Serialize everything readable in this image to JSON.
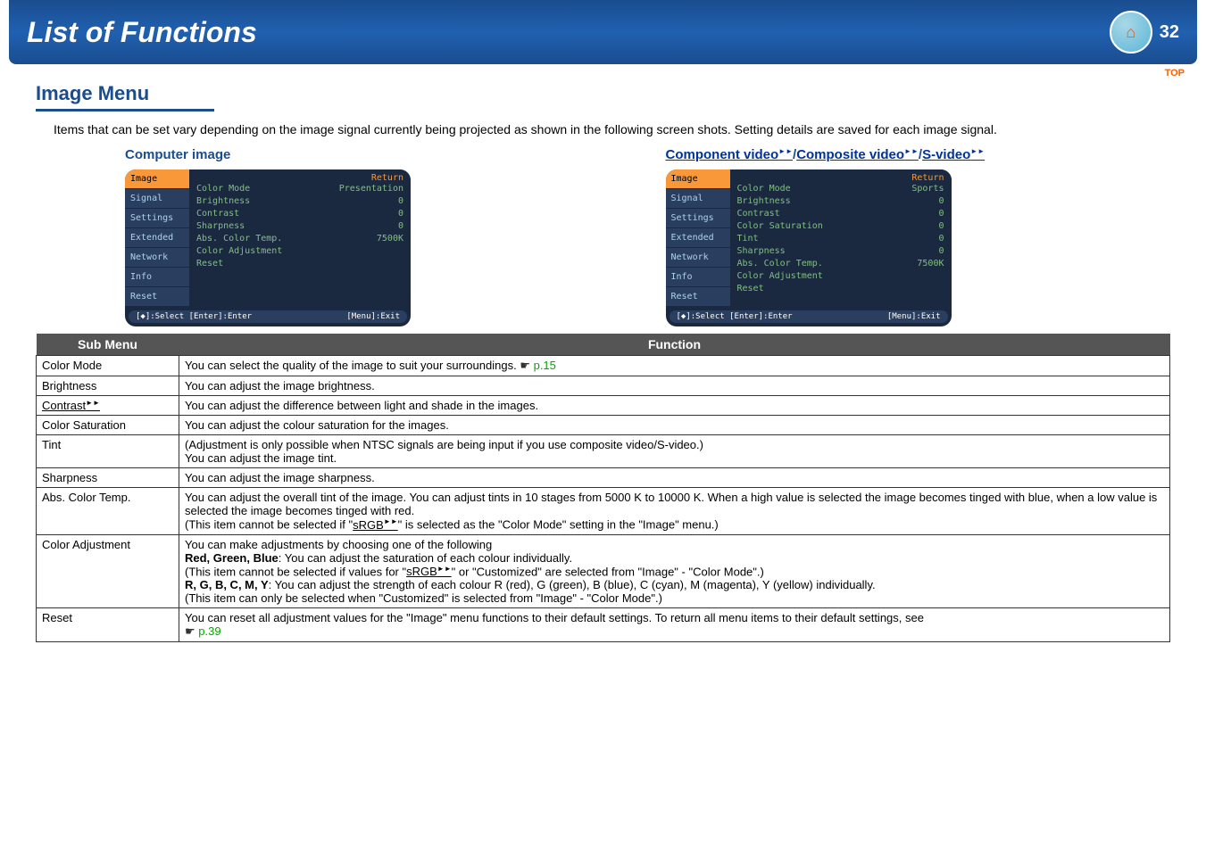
{
  "header": {
    "title": "List of Functions",
    "page": "32",
    "top_label": "TOP"
  },
  "section": {
    "title": "Image Menu",
    "intro": "Items that can be set vary depending on the image signal currently being projected as shown in the following screen shots. Setting details are saved for each image signal."
  },
  "screenshots": {
    "left": {
      "label": "Computer image",
      "tabs": [
        "Image",
        "Signal",
        "Settings",
        "Extended",
        "Network",
        "Info",
        "Reset"
      ],
      "return": "Return",
      "items": [
        {
          "name": "Color Mode",
          "val": "Presentation"
        },
        {
          "name": "Brightness",
          "val": "0"
        },
        {
          "name": "Contrast",
          "val": "0"
        },
        {
          "name": "Sharpness",
          "val": "0"
        },
        {
          "name": "Abs. Color Temp.",
          "val": "7500K"
        },
        {
          "name": "Color Adjustment",
          "val": ""
        },
        {
          "name": "Reset",
          "val": ""
        }
      ],
      "footer_left": "[◆]:Select [Enter]:Enter",
      "footer_right": "[Menu]:Exit"
    },
    "right": {
      "label_prefix": "",
      "link1": "Component video",
      "sep1": "/",
      "link2": "Composite video",
      "sep2": "/",
      "link3": "S-video",
      "tabs": [
        "Image",
        "Signal",
        "Settings",
        "Extended",
        "Network",
        "Info",
        "Reset"
      ],
      "return": "Return",
      "items": [
        {
          "name": "Color Mode",
          "val": "Sports"
        },
        {
          "name": "Brightness",
          "val": "0"
        },
        {
          "name": "Contrast",
          "val": "0"
        },
        {
          "name": "Color Saturation",
          "val": "0"
        },
        {
          "name": "Tint",
          "val": "0"
        },
        {
          "name": "Sharpness",
          "val": "0"
        },
        {
          "name": "Abs. Color Temp.",
          "val": "7500K"
        },
        {
          "name": "Color Adjustment",
          "val": ""
        },
        {
          "name": "Reset",
          "val": ""
        }
      ],
      "footer_left": "[◆]:Select [Enter]:Enter",
      "footer_right": "[Menu]:Exit"
    }
  },
  "table": {
    "head_sub": "Sub Menu",
    "head_func": "Function",
    "rows": {
      "color_mode": {
        "name": "Color Mode",
        "text": "You can select the quality of the image to suit your surroundings. ",
        "link": "p.15"
      },
      "brightness": {
        "name": "Brightness",
        "text": "You can adjust the image brightness."
      },
      "contrast": {
        "name": "Contrast",
        "text": "You can adjust the difference between light and shade in the images."
      },
      "color_saturation": {
        "name": "Color Saturation",
        "text": "You can adjust the colour saturation for the images."
      },
      "tint": {
        "name": "Tint",
        "line1": "(Adjustment is only possible when NTSC signals are being input if you use composite video/S-video.)",
        "line2": "You can adjust the image tint."
      },
      "sharpness": {
        "name": "Sharpness",
        "text": "You can adjust the image sharpness."
      },
      "abs_color_temp": {
        "name": "Abs. Color Temp.",
        "line1": "You can adjust the overall tint of the image. You can adjust tints in 10 stages from 5000 K to 10000 K. When a high value is selected the image becomes tinged with blue, when a low value is selected the image becomes tinged with red.",
        "line2a": "(This item cannot be selected if \"",
        "line2_link": "sRGB",
        "line2b": "\" is selected as the \"Color Mode\" setting in the \"Image\" menu.)"
      },
      "color_adjustment": {
        "name": "Color Adjustment",
        "line1": "You can make adjustments by choosing one of the following",
        "line2_bold": "Red, Green, Blue",
        "line2_rest": ": You can adjust the saturation of each colour individually.",
        "line3a": "(This item cannot be selected if values for \"",
        "line3_link": "sRGB",
        "line3b": "\" or \"Customized\" are selected from \"Image\" - \"Color Mode\".)",
        "line4_bold": "R, G, B, C, M, Y",
        "line4_rest": ": You can adjust the strength of each colour R (red), G (green), B (blue), C (cyan), M (magenta), Y (yellow) individually.",
        "line5": "(This item can only be selected when \"Customized\" is selected from \"Image\" - \"Color Mode\".)"
      },
      "reset": {
        "name": "Reset",
        "text": "You can reset all adjustment values for the \"Image\" menu functions to their default settings. To return all menu items to their default settings, see ",
        "link": "p.39"
      }
    }
  }
}
